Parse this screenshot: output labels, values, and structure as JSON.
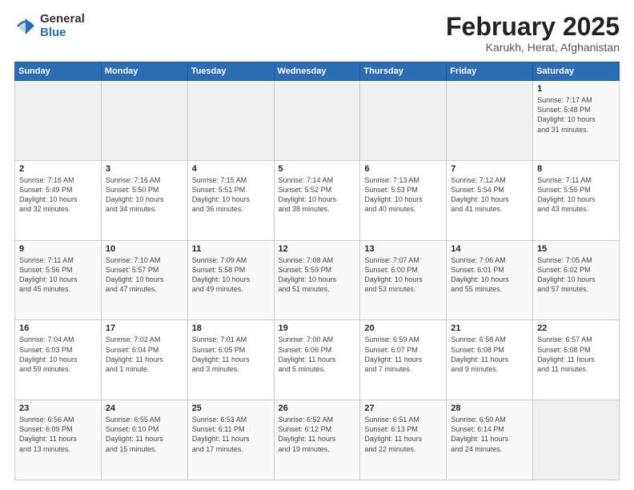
{
  "header": {
    "logo_general": "General",
    "logo_blue": "Blue",
    "month": "February 2025",
    "location": "Karukh, Herat, Afghanistan"
  },
  "weekdays": [
    "Sunday",
    "Monday",
    "Tuesday",
    "Wednesday",
    "Thursday",
    "Friday",
    "Saturday"
  ],
  "weeks": [
    [
      {
        "day": "",
        "info": ""
      },
      {
        "day": "",
        "info": ""
      },
      {
        "day": "",
        "info": ""
      },
      {
        "day": "",
        "info": ""
      },
      {
        "day": "",
        "info": ""
      },
      {
        "day": "",
        "info": ""
      },
      {
        "day": "1",
        "info": "Sunrise: 7:17 AM\nSunset: 5:48 PM\nDaylight: 10 hours\nand 31 minutes."
      }
    ],
    [
      {
        "day": "2",
        "info": "Sunrise: 7:16 AM\nSunset: 5:49 PM\nDaylight: 10 hours\nand 32 minutes."
      },
      {
        "day": "3",
        "info": "Sunrise: 7:16 AM\nSunset: 5:50 PM\nDaylight: 10 hours\nand 34 minutes."
      },
      {
        "day": "4",
        "info": "Sunrise: 7:15 AM\nSunset: 5:51 PM\nDaylight: 10 hours\nand 36 minutes."
      },
      {
        "day": "5",
        "info": "Sunrise: 7:14 AM\nSunset: 5:52 PM\nDaylight: 10 hours\nand 38 minutes."
      },
      {
        "day": "6",
        "info": "Sunrise: 7:13 AM\nSunset: 5:53 PM\nDaylight: 10 hours\nand 40 minutes."
      },
      {
        "day": "7",
        "info": "Sunrise: 7:12 AM\nSunset: 5:54 PM\nDaylight: 10 hours\nand 41 minutes."
      },
      {
        "day": "8",
        "info": "Sunrise: 7:11 AM\nSunset: 5:55 PM\nDaylight: 10 hours\nand 43 minutes."
      }
    ],
    [
      {
        "day": "9",
        "info": "Sunrise: 7:11 AM\nSunset: 5:56 PM\nDaylight: 10 hours\nand 45 minutes."
      },
      {
        "day": "10",
        "info": "Sunrise: 7:10 AM\nSunset: 5:57 PM\nDaylight: 10 hours\nand 47 minutes."
      },
      {
        "day": "11",
        "info": "Sunrise: 7:09 AM\nSunset: 5:58 PM\nDaylight: 10 hours\nand 49 minutes."
      },
      {
        "day": "12",
        "info": "Sunrise: 7:08 AM\nSunset: 5:59 PM\nDaylight: 10 hours\nand 51 minutes."
      },
      {
        "day": "13",
        "info": "Sunrise: 7:07 AM\nSunset: 6:00 PM\nDaylight: 10 hours\nand 53 minutes."
      },
      {
        "day": "14",
        "info": "Sunrise: 7:06 AM\nSunset: 6:01 PM\nDaylight: 10 hours\nand 55 minutes."
      },
      {
        "day": "15",
        "info": "Sunrise: 7:05 AM\nSunset: 6:02 PM\nDaylight: 10 hours\nand 57 minutes."
      }
    ],
    [
      {
        "day": "16",
        "info": "Sunrise: 7:04 AM\nSunset: 6:03 PM\nDaylight: 10 hours\nand 59 minutes."
      },
      {
        "day": "17",
        "info": "Sunrise: 7:02 AM\nSunset: 6:04 PM\nDaylight: 11 hours\nand 1 minute."
      },
      {
        "day": "18",
        "info": "Sunrise: 7:01 AM\nSunset: 6:05 PM\nDaylight: 11 hours\nand 3 minutes."
      },
      {
        "day": "19",
        "info": "Sunrise: 7:00 AM\nSunset: 6:06 PM\nDaylight: 11 hours\nand 5 minutes."
      },
      {
        "day": "20",
        "info": "Sunrise: 6:59 AM\nSunset: 6:07 PM\nDaylight: 11 hours\nand 7 minutes."
      },
      {
        "day": "21",
        "info": "Sunrise: 6:58 AM\nSunset: 6:08 PM\nDaylight: 11 hours\nand 9 minutes."
      },
      {
        "day": "22",
        "info": "Sunrise: 6:57 AM\nSunset: 6:08 PM\nDaylight: 11 hours\nand 11 minutes."
      }
    ],
    [
      {
        "day": "23",
        "info": "Sunrise: 6:56 AM\nSunset: 6:09 PM\nDaylight: 11 hours\nand 13 minutes."
      },
      {
        "day": "24",
        "info": "Sunrise: 6:55 AM\nSunset: 6:10 PM\nDaylight: 11 hours\nand 15 minutes."
      },
      {
        "day": "25",
        "info": "Sunrise: 6:53 AM\nSunset: 6:11 PM\nDaylight: 11 hours\nand 17 minutes."
      },
      {
        "day": "26",
        "info": "Sunrise: 6:52 AM\nSunset: 6:12 PM\nDaylight: 11 hours\nand 19 minutes."
      },
      {
        "day": "27",
        "info": "Sunrise: 6:51 AM\nSunset: 6:13 PM\nDaylight: 11 hours\nand 22 minutes."
      },
      {
        "day": "28",
        "info": "Sunrise: 6:50 AM\nSunset: 6:14 PM\nDaylight: 11 hours\nand 24 minutes."
      },
      {
        "day": "",
        "info": ""
      }
    ]
  ]
}
